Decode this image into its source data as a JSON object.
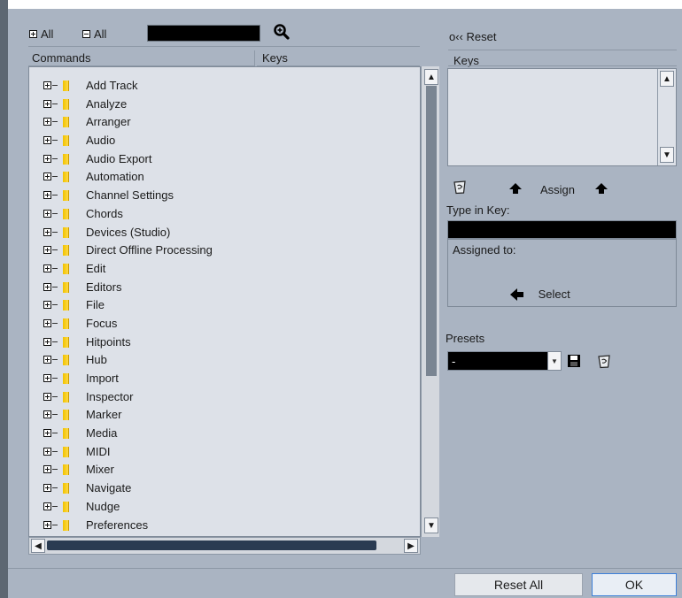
{
  "toolbar": {
    "expand_all_label": "All",
    "collapse_all_label": "All",
    "search_value": "",
    "reset_label": "o‹‹ Reset"
  },
  "columns": {
    "commands": "Commands",
    "keys": "Keys"
  },
  "tree_items": [
    "Add Track",
    "Analyze",
    "Arranger",
    "Audio",
    "Audio Export",
    "Automation",
    "Channel Settings",
    "Chords",
    "Devices (Studio)",
    "Direct Offline Processing",
    "Edit",
    "Editors",
    "File",
    "Focus",
    "Hitpoints",
    "Hub",
    "Import",
    "Inspector",
    "Marker",
    "Media",
    "MIDI",
    "Mixer",
    "Navigate",
    "Nudge",
    "Preferences"
  ],
  "right_panel": {
    "keys_header": "Keys",
    "assign_label": "Assign",
    "type_in_key_label": "Type in Key:",
    "type_in_key_value": "",
    "assigned_to_label": "Assigned to:",
    "select_label": "Select",
    "presets_label": "Presets",
    "preset_value": "-"
  },
  "footer": {
    "reset_all_label": "Reset All",
    "ok_label": "OK"
  },
  "colors": {
    "background": "#aab4c2",
    "accent": "#3c7fd8",
    "folder": "#f0c200"
  },
  "icons": [
    "expand-all-icon",
    "collapse-all-icon",
    "magnifier-icon",
    "trash-icon",
    "up-arrow-icon",
    "left-arrow-icon",
    "save-icon",
    "folder-icon"
  ]
}
